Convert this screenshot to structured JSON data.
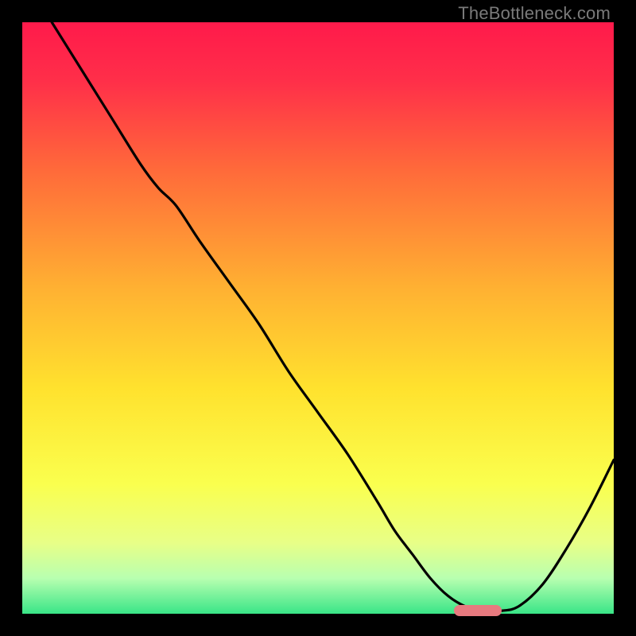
{
  "watermark": "TheBottleneck.com",
  "colors": {
    "gradient_stops": [
      {
        "offset": 0.0,
        "color": "#ff1a4b"
      },
      {
        "offset": 0.1,
        "color": "#ff2f49"
      },
      {
        "offset": 0.25,
        "color": "#ff6a3a"
      },
      {
        "offset": 0.45,
        "color": "#ffb132"
      },
      {
        "offset": 0.62,
        "color": "#ffe22e"
      },
      {
        "offset": 0.78,
        "color": "#faff4e"
      },
      {
        "offset": 0.88,
        "color": "#e8ff87"
      },
      {
        "offset": 0.94,
        "color": "#b8ffb0"
      },
      {
        "offset": 1.0,
        "color": "#39e587"
      }
    ],
    "curve": "#000000",
    "marker": "#e77a7f",
    "background": "#000000"
  },
  "chart_data": {
    "type": "line",
    "title": "",
    "xlabel": "",
    "ylabel": "",
    "xlim": [
      0,
      100
    ],
    "ylim": [
      0,
      100
    ],
    "grid": false,
    "series": [
      {
        "name": "curve",
        "x": [
          5,
          10,
          15,
          20,
          23,
          26,
          30,
          35,
          40,
          45,
          50,
          55,
          60,
          63,
          66,
          69,
          72,
          75,
          78,
          81,
          84,
          88,
          92,
          96,
          100
        ],
        "y": [
          100,
          92,
          84,
          76,
          72,
          69,
          63,
          56,
          49,
          41,
          34,
          27,
          19,
          14,
          10,
          6,
          3,
          1.2,
          0.5,
          0.5,
          1.3,
          5,
          11,
          18,
          26
        ]
      }
    ],
    "marker": {
      "x_start": 73,
      "x_end": 81,
      "y": 0.6
    }
  }
}
